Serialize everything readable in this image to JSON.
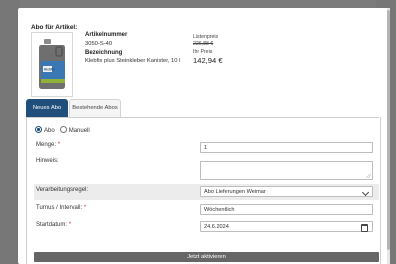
{
  "product": {
    "section_title": "Abo für Artikel:",
    "article_number_label": "Artikelnummer",
    "article_number": "3050-S-40",
    "description_label": "Bezeichnung",
    "description": "Klebfix plus Steinkleber Kanister, 10 l",
    "list_price_label": "Listenpreis",
    "list_price": "226,88 €",
    "your_price_label": "Ihr Preis",
    "your_price": "142,94 €",
    "image_brand": "Klebfix",
    "image_icon": "canister-image"
  },
  "tabs": [
    {
      "label": "Neues Abo",
      "active": true
    },
    {
      "label": "Bestehende Abos",
      "active": false
    }
  ],
  "form": {
    "type_options": [
      {
        "label": "Abo",
        "checked": true
      },
      {
        "label": "Manuell",
        "checked": false
      }
    ],
    "quantity_label": "Menge:",
    "quantity_value": "1",
    "note_label": "Hinweis:",
    "note_value": "",
    "processing_rule_label": "Verarbeitungsregel:",
    "processing_rule_value": "Abo Lieferungen Weimar",
    "interval_label": "Turnus / Intervall:",
    "interval_value": "Wöchentlich",
    "start_date_label": "Startdatum:",
    "start_date_value": "24.6.2024",
    "required_mark": "*",
    "submit_label": "Jetzt aktivieren"
  },
  "colors": {
    "accent": "#1f4f7a",
    "submit_bg": "#666666",
    "required": "#c0392b"
  }
}
